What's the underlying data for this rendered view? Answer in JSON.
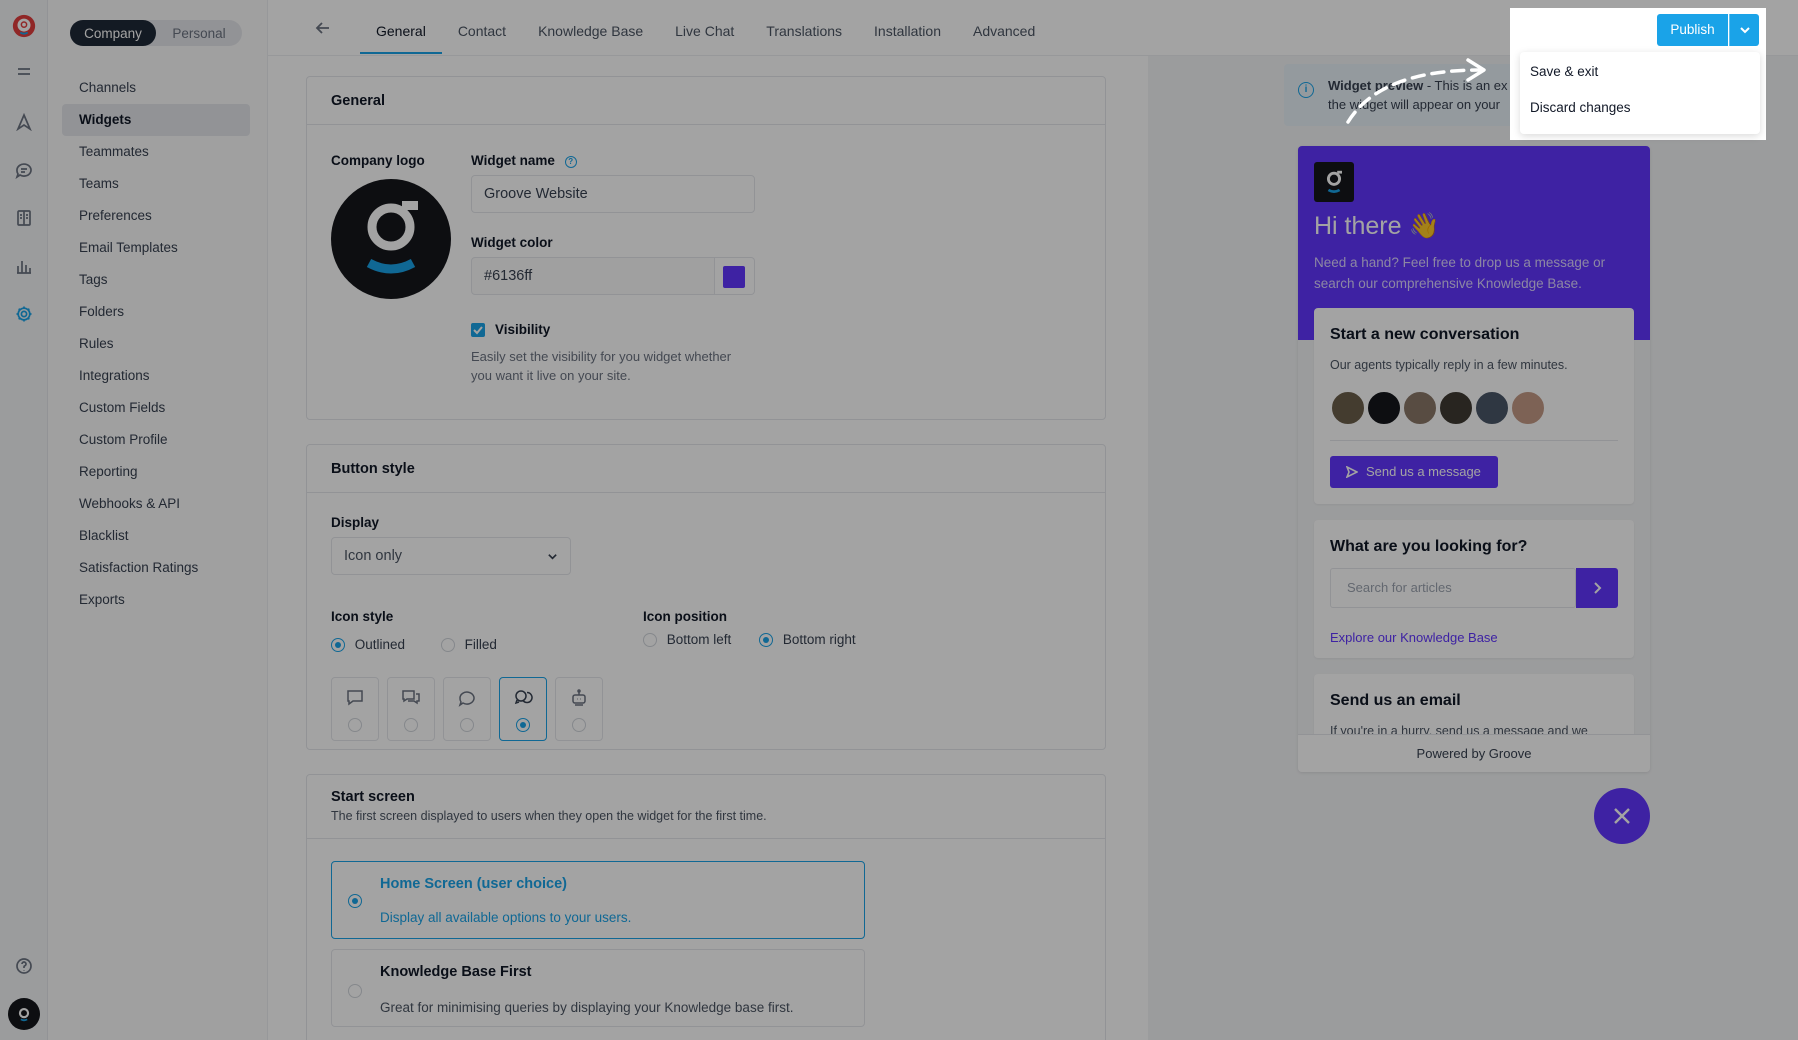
{
  "colors": {
    "accent": "#1aa3e8",
    "widget": "#6136ff"
  },
  "rail": {
    "icons": [
      "groove-logo-icon",
      "menu-icon",
      "send-icon",
      "chat-icon",
      "book-icon",
      "chart-icon",
      "gear-icon",
      "help-icon",
      "user-avatar-icon"
    ]
  },
  "nav": {
    "segment": {
      "company": "Company",
      "personal": "Personal",
      "active": "Company"
    },
    "items": [
      "Channels",
      "Widgets",
      "Teammates",
      "Teams",
      "Preferences",
      "Email Templates",
      "Tags",
      "Folders",
      "Rules",
      "Integrations",
      "Custom Fields",
      "Custom Profile",
      "Reporting",
      "Webhooks & API",
      "Blacklist",
      "Satisfaction Ratings",
      "Exports"
    ],
    "active": "Widgets"
  },
  "tabs": [
    "General",
    "Contact",
    "Knowledge Base",
    "Live Chat",
    "Translations",
    "Installation",
    "Advanced"
  ],
  "active_tab": "General",
  "general": {
    "heading": "General",
    "company_logo_label": "Company logo",
    "widget_name_label": "Widget name",
    "widget_name_value": "Groove Website",
    "widget_color_label": "Widget color",
    "widget_color_value": "#6136ff",
    "visibility_label": "Visibility",
    "visibility_checked": true,
    "visibility_help": "Easily set the visibility for you widget whether you want it live on your site."
  },
  "button_style": {
    "heading": "Button style",
    "display_label": "Display",
    "display_value": "Icon only",
    "icon_style_label": "Icon style",
    "icon_style_options": [
      "Outlined",
      "Filled"
    ],
    "icon_style_selected": "Outlined",
    "icon_position_label": "Icon position",
    "icon_position_options": [
      "Bottom left",
      "Bottom right"
    ],
    "icon_position_selected": "Bottom right",
    "icons": [
      "chat-square-icon",
      "chat-double-icon",
      "chat-round-icon",
      "chat-round-double-icon",
      "robot-icon"
    ],
    "icon_selected_index": 3
  },
  "start_screen": {
    "heading": "Start screen",
    "subheading": "The first screen displayed to users when they open the widget for the first time.",
    "options": [
      {
        "title": "Home Screen (user choice)",
        "desc": "Display all available options to your users."
      },
      {
        "title": "Knowledge Base First",
        "desc": "Great for minimising queries by displaying your Knowledge base first."
      }
    ],
    "selected_index": 0
  },
  "preview": {
    "info_bold": "Widget preview",
    "info_text": " - This is an exa",
    "info_line2": "the widget will appear on your",
    "greeting": "Hi there 👋",
    "intro": "Need a hand? Feel free to drop us a message or search our comprehensive Knowledge Base.",
    "conversation_title": "Start a new conversation",
    "conversation_sub": "Our agents typically reply in a few minutes.",
    "send_button": "Send us a message",
    "kb_title": "What are you looking for?",
    "search_placeholder": "Search for articles",
    "kb_link": "Explore our Knowledge Base",
    "email_title": "Send us an email",
    "email_cut": "If you're in a hurry, send us a message and we",
    "footer": "Powered by Groove"
  },
  "publish": {
    "button": "Publish",
    "menu": [
      "Save & exit",
      "Discard changes"
    ]
  }
}
